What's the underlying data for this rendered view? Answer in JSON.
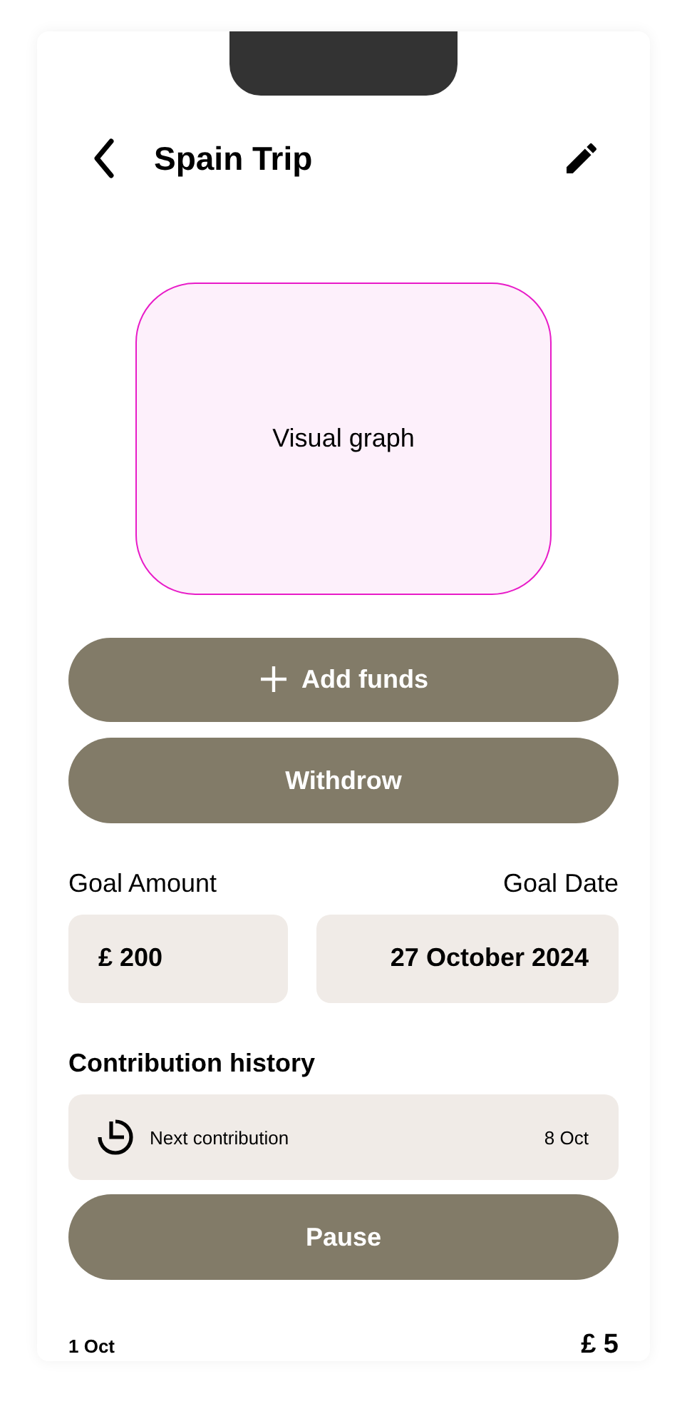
{
  "header": {
    "title": "Spain Trip"
  },
  "graph": {
    "label": "Visual graph"
  },
  "actions": [
    {
      "kind": "add",
      "label": "Add funds"
    },
    {
      "kind": "plain",
      "label": "Withdrow"
    }
  ],
  "goal": {
    "amount_label": "Goal Amount",
    "date_label": "Goal Date",
    "amount": "£ 200",
    "date": "27 October 2024"
  },
  "history": {
    "title": "Contribution history",
    "next_label": "Next contribution",
    "next_date": "8 Oct",
    "pause_button": "Pause",
    "entries": [
      {
        "date": "1 Oct",
        "amount": "£ 5"
      }
    ]
  }
}
